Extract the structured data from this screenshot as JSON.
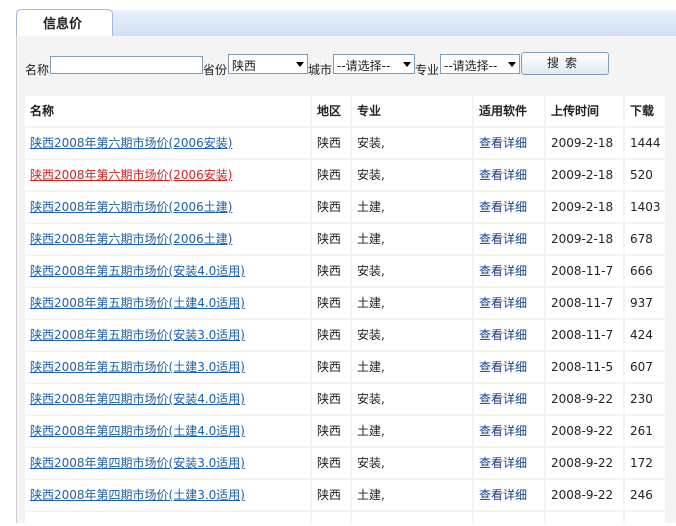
{
  "tab": {
    "label": "信息价"
  },
  "search": {
    "name_label": "名称",
    "name_value": "",
    "province_label": "省份",
    "province_value": "陕西",
    "city_label": "城市",
    "city_value": "--请选择--",
    "major_label": "专业",
    "major_value": "--请选择--",
    "button_label": "搜索"
  },
  "table": {
    "headers": [
      "名称",
      "地区",
      "专业",
      "适用软件",
      "上传时间",
      "下载"
    ],
    "rows": [
      {
        "name": "陕西2008年第六期市场价(2006安装)",
        "region": "陕西",
        "major": "安装,",
        "software": "查看详细",
        "date": "2009-2-18",
        "downloads": "1444"
      },
      {
        "name": "陕西2008年第六期市场价(2006安装)",
        "region": "陕西",
        "major": "安装,",
        "software": "查看详细",
        "date": "2009-2-18",
        "downloads": "520"
      },
      {
        "name": "陕西2008年第六期市场价(2006土建)",
        "region": "陕西",
        "major": "土建,",
        "software": "查看详细",
        "date": "2009-2-18",
        "downloads": "1403"
      },
      {
        "name": "陕西2008年第六期市场价(2006土建)",
        "region": "陕西",
        "major": "土建,",
        "software": "查看详细",
        "date": "2009-2-18",
        "downloads": "678"
      },
      {
        "name": "陕西2008年第五期市场价(安装4.0适用)",
        "region": "陕西",
        "major": "安装,",
        "software": "查看详细",
        "date": "2008-11-7",
        "downloads": "666"
      },
      {
        "name": "陕西2008年第五期市场价(土建4.0适用)",
        "region": "陕西",
        "major": "土建,",
        "software": "查看详细",
        "date": "2008-11-7",
        "downloads": "937"
      },
      {
        "name": "陕西2008年第五期市场价(安装3.0适用)",
        "region": "陕西",
        "major": "安装,",
        "software": "查看详细",
        "date": "2008-11-7",
        "downloads": "424"
      },
      {
        "name": "陕西2008年第五期市场价(土建3.0适用)",
        "region": "陕西",
        "major": "土建,",
        "software": "查看详细",
        "date": "2008-11-5",
        "downloads": "607"
      },
      {
        "name": "陕西2008年第四期市场价(安装4.0适用)",
        "region": "陕西",
        "major": "安装,",
        "software": "查看详细",
        "date": "2008-9-22",
        "downloads": "230"
      },
      {
        "name": "陕西2008年第四期市场价(土建4.0适用)",
        "region": "陕西",
        "major": "土建,",
        "software": "查看详细",
        "date": "2008-9-22",
        "downloads": "261"
      },
      {
        "name": "陕西2008年第四期市场价(安装3.0适用)",
        "region": "陕西",
        "major": "安装,",
        "software": "查看详细",
        "date": "2008-9-22",
        "downloads": "172"
      },
      {
        "name": "陕西2008年第四期市场价(土建3.0适用)",
        "region": "陕西",
        "major": "土建,",
        "software": "查看详细",
        "date": "2008-9-22",
        "downloads": "246"
      }
    ]
  },
  "colors": {
    "link": "#1a5fb4",
    "link_active": "#d9201e"
  }
}
